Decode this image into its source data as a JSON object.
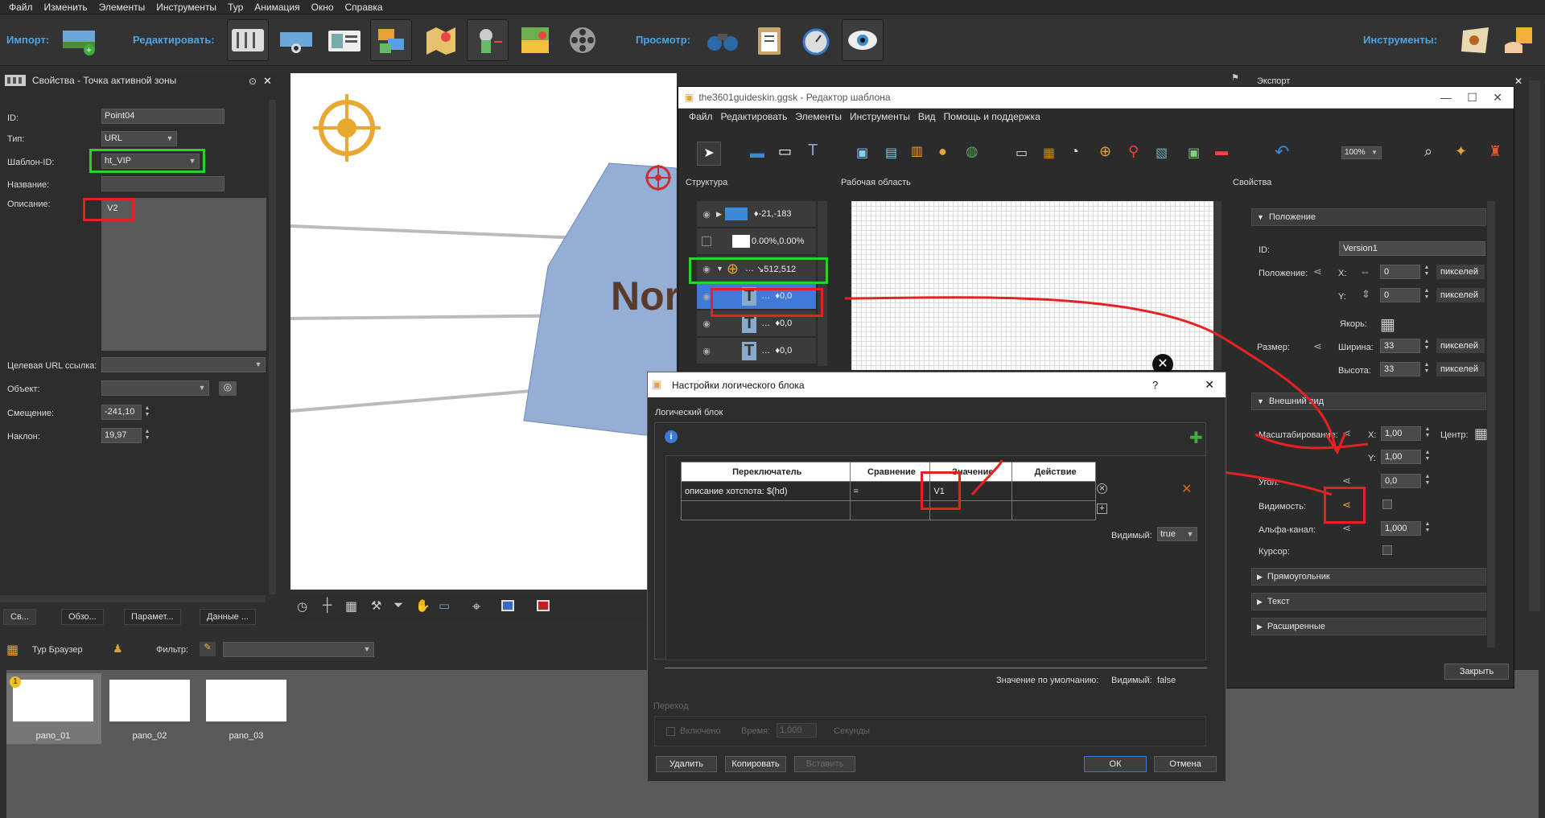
{
  "menu": [
    "Файл",
    "Изменить",
    "Элементы",
    "Инструменты",
    "Тур",
    "Анимация",
    "Окно",
    "Справка"
  ],
  "toolbar": {
    "import_label": "Импорт:",
    "edit_label": "Редактировать:",
    "view_label": "Просмотр:",
    "tools_label": "Инструменты:"
  },
  "left_panel": {
    "title": "Свойства - Точка активной зоны",
    "fields": {
      "id_label": "ID:",
      "id_value": "Point04",
      "type_label": "Тип:",
      "type_value": "URL",
      "template_label": "Шаблон-ID:",
      "template_value": "ht_VIP",
      "name_label": "Название:",
      "name_value": "",
      "desc_label": "Описание:",
      "desc_value": "V2",
      "url_label": "Целевая URL ссылка:",
      "url_value": "",
      "object_label": "Объект:",
      "object_value": "",
      "offset_label": "Смещение:",
      "offset_value": "-241,10",
      "tilt_label": "Наклон:",
      "tilt_value": "19,97"
    },
    "tabs": [
      "Св...",
      "Обзо...",
      "Парамет...",
      "Данные ..."
    ]
  },
  "viewer": {
    "text": "Nor"
  },
  "tour": {
    "title": "Тур Браузер",
    "filter_label": "Фильтр:",
    "thumbs": [
      {
        "label": "pano_01",
        "badge": "1"
      },
      {
        "label": "pano_02"
      },
      {
        "label": "pano_03"
      }
    ]
  },
  "skin_editor": {
    "title": "the3601guideskin.ggsk - Редактор шаблона",
    "menu": [
      "Файл",
      "Редактировать",
      "Элементы",
      "Инструменты",
      "Вид",
      "Помощь и поддержка"
    ],
    "zoom": "100%",
    "structure_label": "Структура",
    "workspace_label": "Рабочая область",
    "props_label": "Свойства",
    "export_label": "Экспорт",
    "close_button": "Закрыть",
    "tree": [
      {
        "text": "♦-21,-183"
      },
      {
        "text": "0.00%,0.00%"
      },
      {
        "text": "↘512,512"
      },
      {
        "text": "♦0,0"
      },
      {
        "text": "♦0,0"
      },
      {
        "text": "♦0,0"
      }
    ],
    "props": {
      "section_position": "Положение",
      "id_label": "ID:",
      "id_value": "Version1",
      "position_label": "Положение:",
      "x_label": "X:",
      "x_value": "0",
      "y_label": "Y:",
      "y_value": "0",
      "unit_px": "пикселей",
      "anchor_label": "Якорь:",
      "size_label": "Размер:",
      "width_label": "Ширина:",
      "width_value": "33",
      "height_label": "Высота:",
      "height_value": "33",
      "section_appearance": "Внешний вид",
      "scale_label": "Масштабирование:",
      "scale_x": "1,00",
      "scale_y": "1,00",
      "center_label": "Центр:",
      "angle_label": "Угол:",
      "angle_value": "0,0",
      "visibility_label": "Видимость:",
      "alpha_label": "Альфа-канал:",
      "alpha_value": "1,000",
      "cursor_label": "Курсор:",
      "section_rect": "Прямоугольник",
      "section_text": "Текст",
      "section_ext": "Расширенные"
    }
  },
  "dialog": {
    "title": "Настройки логического блока",
    "help": "?",
    "group_label": "Логический блок",
    "columns": [
      "Переключатель",
      "Сравнение",
      "Значение",
      "Действие"
    ],
    "row": {
      "switch": "описание хотспота: $(hd)",
      "compare": "=",
      "value": "V1",
      "action": ""
    },
    "visible_label": "Видимый:",
    "visible_value": "true",
    "default_label": "Значение по умолчанию:",
    "default_visible_label": "Видимый:",
    "default_visible_value": "false",
    "transition_label": "Переход",
    "enabled_label": "Включено",
    "time_label": "Время:",
    "time_value": "1,000",
    "seconds_label": "Секунды",
    "buttons": {
      "delete": "Удалить",
      "copy": "Копировать",
      "paste": "Вставить",
      "ok": "ОК",
      "cancel": "Отмена"
    }
  },
  "colors": {
    "accent": "#4aa6e6",
    "highlight_red": "#e52222",
    "highlight_green": "#2bd22b",
    "selection": "#3f7ad8"
  }
}
